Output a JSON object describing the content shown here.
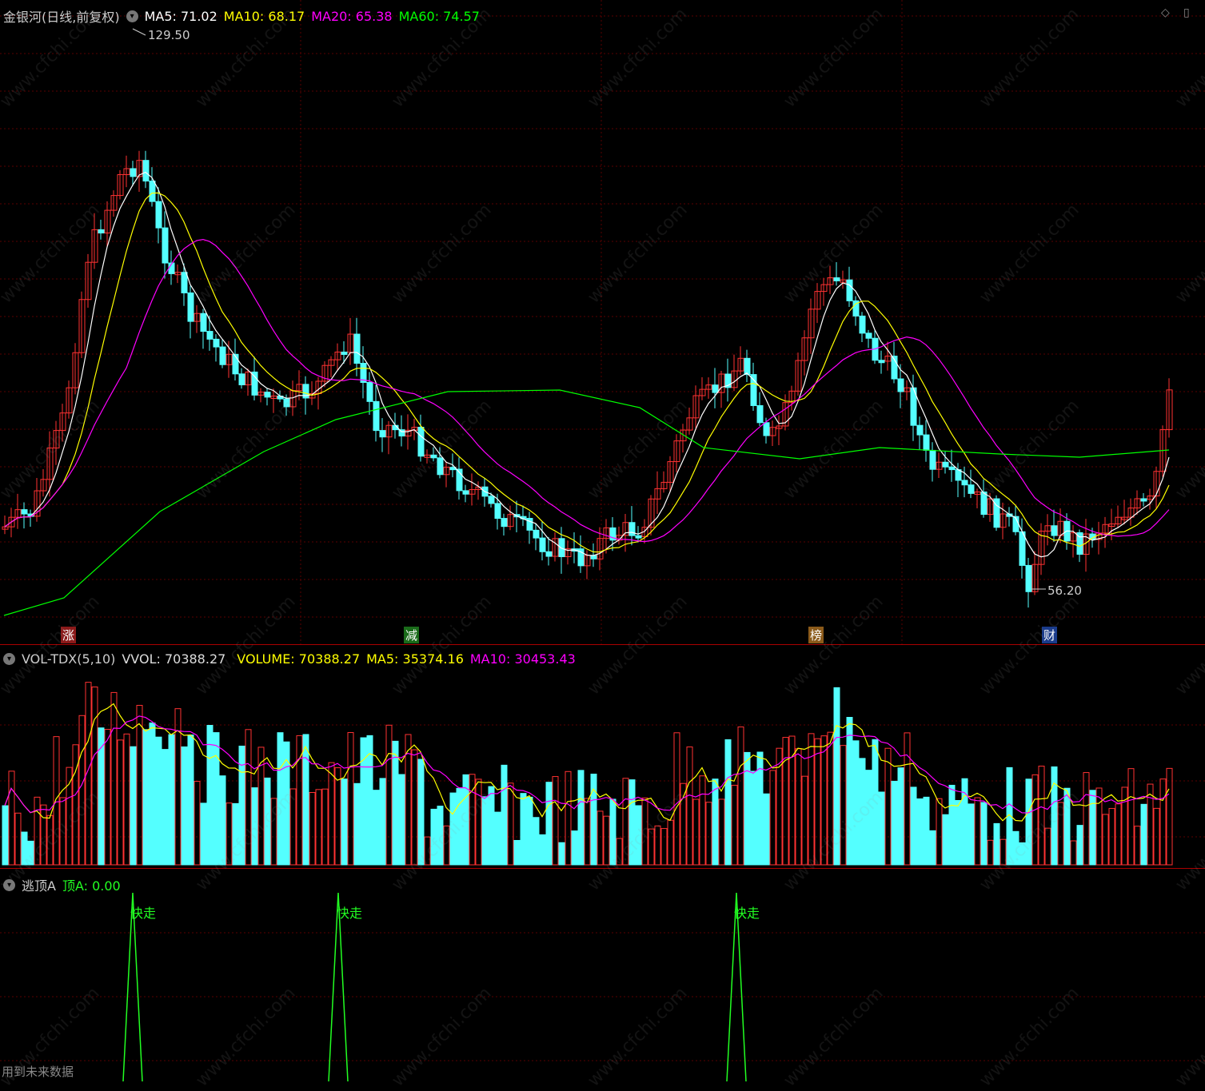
{
  "main": {
    "title": "金银河(日线,前复权)",
    "ma5_label": "MA5: 71.02",
    "ma10_label": "MA10: 68.17",
    "ma20_label": "MA20: 65.38",
    "ma60_label": "MA60: 74.57",
    "high_label": "129.50",
    "low_label": "56.20",
    "tags": [
      "涨",
      "减",
      "榜",
      "财"
    ],
    "colors": {
      "ma5": "#ffffff",
      "ma10": "#ffff00",
      "ma20": "#ff00ff",
      "ma60": "#00ff00",
      "up": "#ff3232",
      "down": "#54ffff"
    }
  },
  "volume": {
    "title": "VOL-TDX(5,10)",
    "vvol_label": "VVOL: 70388.27",
    "volume_label": "VOLUME: 70388.27",
    "ma5_label": "MA5: 35374.16",
    "ma10_label": "MA10: 30453.43"
  },
  "indicator": {
    "title": "逃顶A",
    "value_label": "顶A: 0.00",
    "signal_label": "快走",
    "footer": "用到未来数据"
  },
  "watermark": "www.cfchi.com",
  "chart_data": {
    "type": "candlestick",
    "price_high": 129.5,
    "price_low": 56.2,
    "highlight_markers": [
      "涨",
      "减",
      "榜",
      "财"
    ],
    "ma_last": {
      "MA5": 71.02,
      "MA10": 68.17,
      "MA20": 65.38,
      "MA60": 74.57
    },
    "volume_last": {
      "VVOL": 70388.27,
      "VOLUME": 70388.27,
      "MA5": 35374.16,
      "MA10": 30453.43
    },
    "indicator_last": {
      "顶A": 0.0
    },
    "signal_count": 3
  }
}
